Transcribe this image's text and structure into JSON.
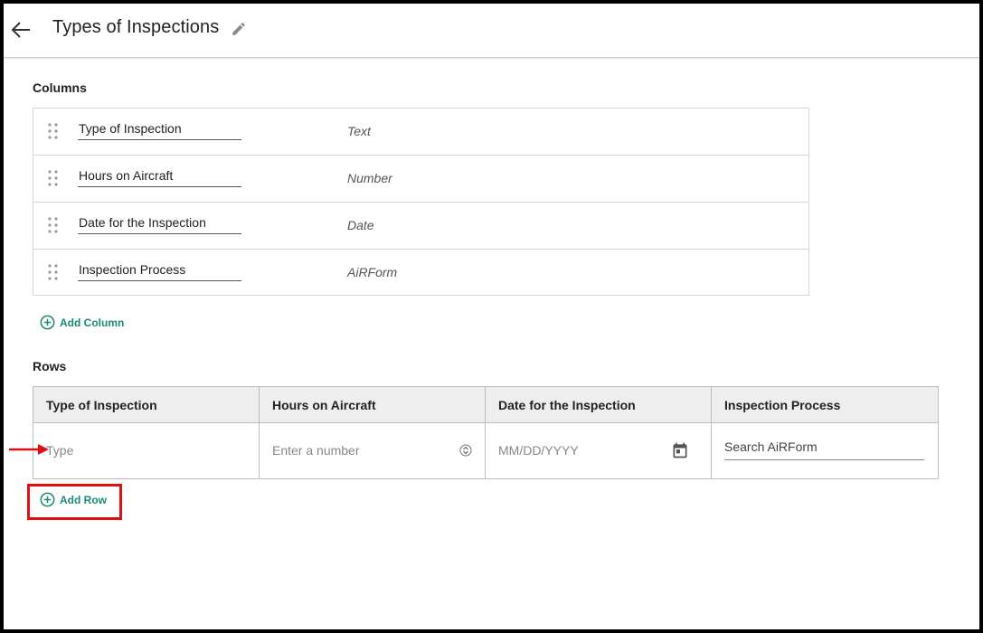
{
  "header": {
    "title": "Types of Inspections"
  },
  "columns_section": {
    "label": "Columns",
    "items": [
      {
        "name": "Type of Inspection",
        "type": "Text"
      },
      {
        "name": "Hours on Aircraft",
        "type": "Number"
      },
      {
        "name": "Date for the Inspection",
        "type": "Date"
      },
      {
        "name": "Inspection Process",
        "type": "AiRForm"
      }
    ],
    "add_label": "Add Column"
  },
  "rows_section": {
    "label": "Rows",
    "headers": [
      "Type of Inspection",
      "Hours on Aircraft",
      "Date for the Inspection",
      "Inspection Process"
    ],
    "placeholders": {
      "type": "Type",
      "hours": "Enter a number",
      "date": "MM/DD/YYYY",
      "process": "Search AiRForm"
    },
    "add_label": "Add Row"
  },
  "colors": {
    "accent": "#1a8a76",
    "annotation": "#e01010",
    "header_bg": "#eeeeee"
  }
}
